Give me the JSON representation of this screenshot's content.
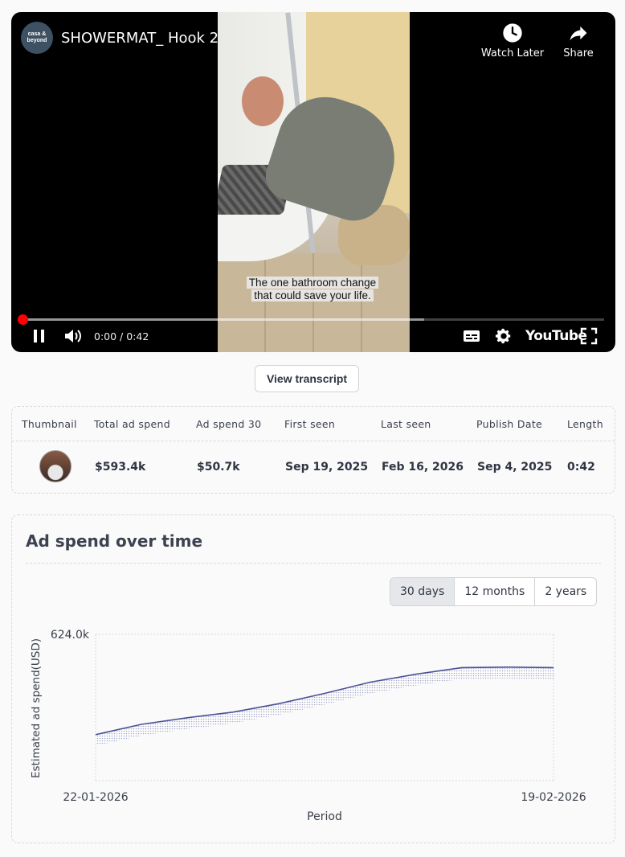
{
  "video": {
    "channel_avatar_text": "casa & beyond",
    "title": "SHOWERMAT_ Hook 2",
    "watch_later_label": "Watch Later",
    "share_label": "Share",
    "caption_line1": "The one bathroom change",
    "caption_line2": "that could save your life.",
    "time": "0:00 / 0:42",
    "logo_text": "YouTube",
    "progress": 0,
    "buffered_fraction": 0.69
  },
  "transcript_button": "View transcript",
  "stats": {
    "headers": [
      "Thumbnail",
      "Total ad spend",
      "Ad spend 30",
      "First seen",
      "Last seen",
      "Publish Date",
      "Length"
    ],
    "values": {
      "total_ad_spend": "$593.4k",
      "ad_spend_30": "$50.7k",
      "first_seen": "Sep 19, 2025",
      "last_seen": "Feb 16, 2026",
      "publish_date": "Sep 4, 2025",
      "length": "0:42"
    }
  },
  "chart_section": {
    "title": "Ad spend over time",
    "ranges": [
      "30 days",
      "12 months",
      "2 years"
    ],
    "active_range": "30 days"
  },
  "chart_data": {
    "type": "area",
    "ylabel": "Estimated ad spend(USD)",
    "xlabel": "Period",
    "y_tick_label": "624.0k",
    "x_tick_labels": [
      "22-01-2026",
      "19-02-2026"
    ],
    "ylim": [
      0,
      624000
    ],
    "line_color": "#4a5296",
    "x": [
      "22-01-2026",
      "25-01-2026",
      "28-01-2026",
      "31-01-2026",
      "03-02-2026",
      "06-02-2026",
      "09-02-2026",
      "12-02-2026",
      "15-02-2026",
      "16-02-2026",
      "19-02-2026"
    ],
    "values": [
      196000,
      240000,
      268000,
      292000,
      328000,
      372000,
      420000,
      454000,
      482000,
      484000,
      482000
    ]
  }
}
